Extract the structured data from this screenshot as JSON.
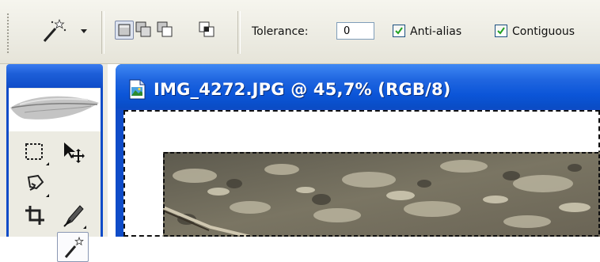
{
  "options_bar": {
    "tool_preset_icon": "magic-wand-icon",
    "selection_modes": [
      {
        "id": "new-selection",
        "icon": "new-selection-icon",
        "active": true
      },
      {
        "id": "add-to-selection",
        "icon": "add-to-selection-icon",
        "active": false
      },
      {
        "id": "subtract-from-selection",
        "icon": "subtract-from-selection-icon",
        "active": false
      },
      {
        "id": "intersect-with-selection",
        "icon": "intersect-selection-icon",
        "active": false
      }
    ],
    "tolerance_label": "Tolerance:",
    "tolerance_value": "0",
    "anti_alias_label": "Anti-alias",
    "anti_alias_checked": true,
    "contiguous_label": "Contiguous",
    "contiguous_checked": true
  },
  "toolbox": {
    "logo_icon": "feather-icon",
    "tools": [
      {
        "name": "rectangular-marquee-tool",
        "icon": "rect-marquee-icon",
        "active": false
      },
      {
        "name": "move-tool",
        "icon": "move-icon",
        "active": false
      },
      {
        "name": "lasso-tool",
        "icon": "lasso-icon",
        "active": false
      },
      {
        "name": "magic-wand-tool",
        "icon": "magic-wand-icon",
        "active": true
      },
      {
        "name": "crop-tool",
        "icon": "crop-icon",
        "active": false
      },
      {
        "name": "slice-tool",
        "icon": "slice-icon",
        "active": false
      }
    ]
  },
  "document": {
    "title": "IMG_4272.JPG @ 45,7% (RGB/8)",
    "icon": "image-document-icon"
  },
  "colors": {
    "titlebar_blue": "#0f4cc8",
    "options_bg": "#ecebe2",
    "checkbox_check": "#21a121"
  }
}
